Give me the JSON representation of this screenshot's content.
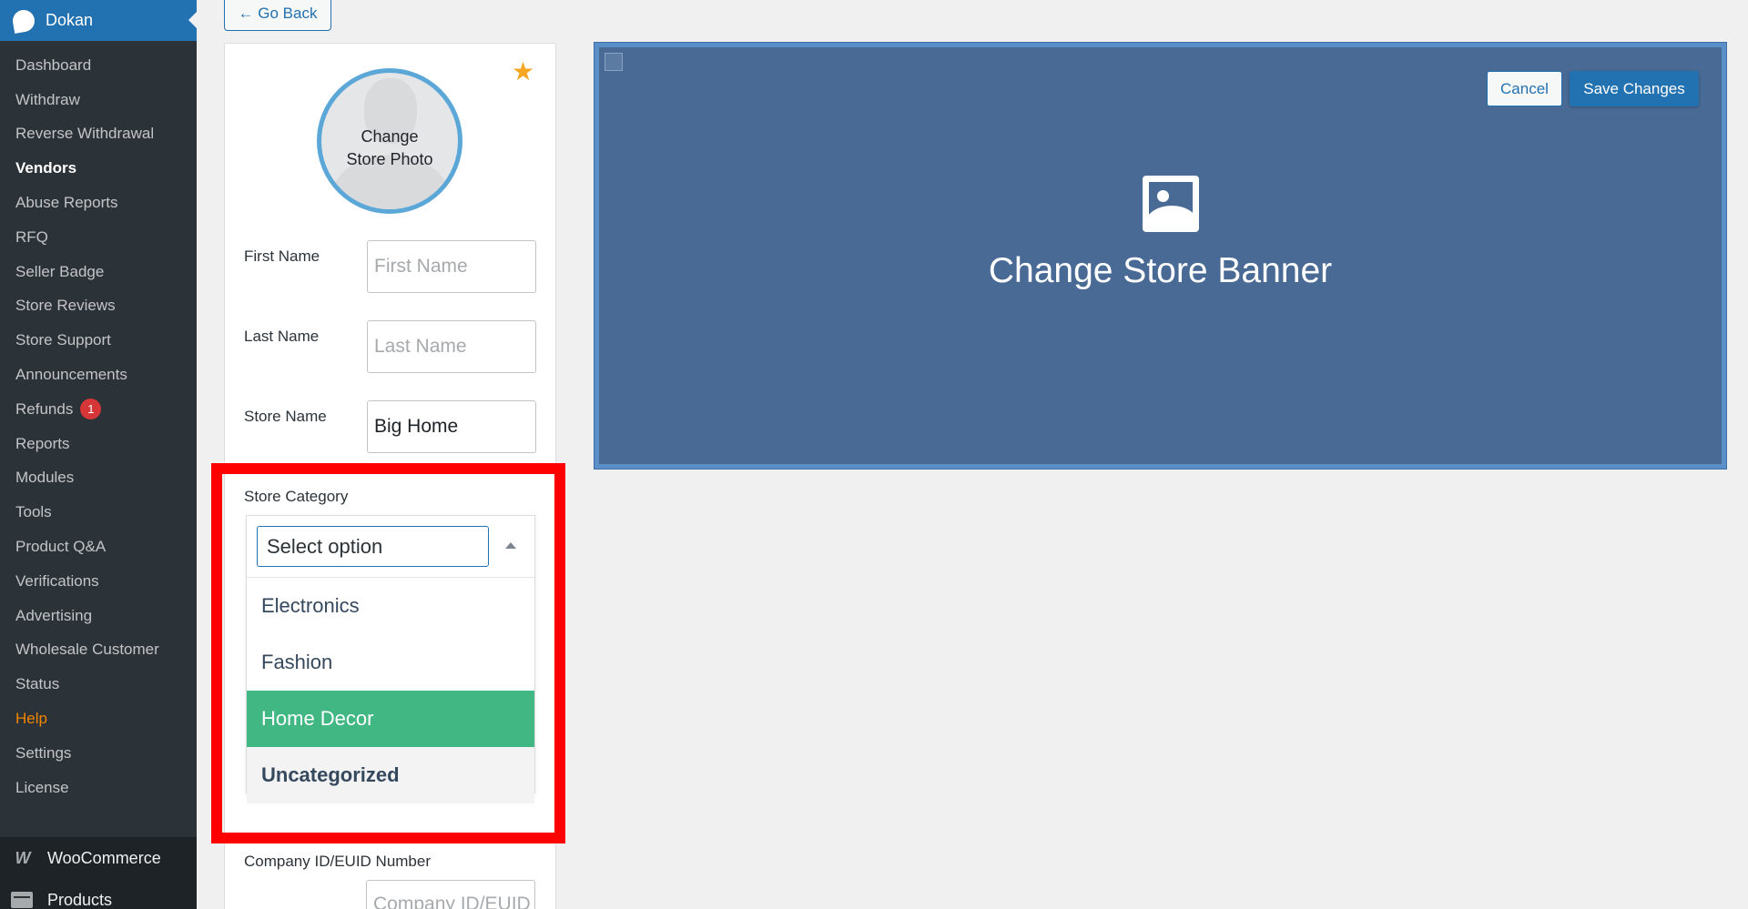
{
  "sidebar": {
    "title": "Dokan",
    "items": [
      {
        "label": "Dashboard"
      },
      {
        "label": "Withdraw"
      },
      {
        "label": "Reverse Withdrawal"
      },
      {
        "label": "Vendors"
      },
      {
        "label": "Abuse Reports"
      },
      {
        "label": "RFQ"
      },
      {
        "label": "Seller Badge"
      },
      {
        "label": "Store Reviews"
      },
      {
        "label": "Store Support"
      },
      {
        "label": "Announcements"
      },
      {
        "label": "Refunds",
        "badge": "1"
      },
      {
        "label": "Reports"
      },
      {
        "label": "Modules"
      },
      {
        "label": "Tools"
      },
      {
        "label": "Product Q&A"
      },
      {
        "label": "Verifications"
      },
      {
        "label": "Advertising"
      },
      {
        "label": "Wholesale Customer"
      },
      {
        "label": "Status"
      },
      {
        "label": "Help"
      },
      {
        "label": "Settings"
      },
      {
        "label": "License"
      }
    ],
    "woocommerce": "WooCommerce",
    "products": "Products"
  },
  "go_back": "← Go Back",
  "form": {
    "photo_label_1": "Change",
    "photo_label_2": "Store Photo",
    "first_name_label": "First Name",
    "first_name_placeholder": "First Name",
    "last_name_label": "Last Name",
    "last_name_placeholder": "Last Name",
    "store_name_label": "Store Name",
    "store_name_value": "Big Home",
    "category_label": "Store Category",
    "category_search_placeholder": "Select option",
    "category_options": [
      "Electronics",
      "Fashion",
      "Home Decor",
      "Uncategorized"
    ],
    "company_label": "Company ID/EUID Number",
    "company_placeholder": "Company ID/EUID"
  },
  "banner": {
    "cancel": "Cancel",
    "save": "Save Changes",
    "title": "Change Store Banner"
  },
  "colors": {
    "sidebar_bg": "#1d2327",
    "accent": "#2271b1",
    "highlight": "#41b883",
    "banner_bg": "#4a6a96",
    "annotation": "#ff0000"
  }
}
